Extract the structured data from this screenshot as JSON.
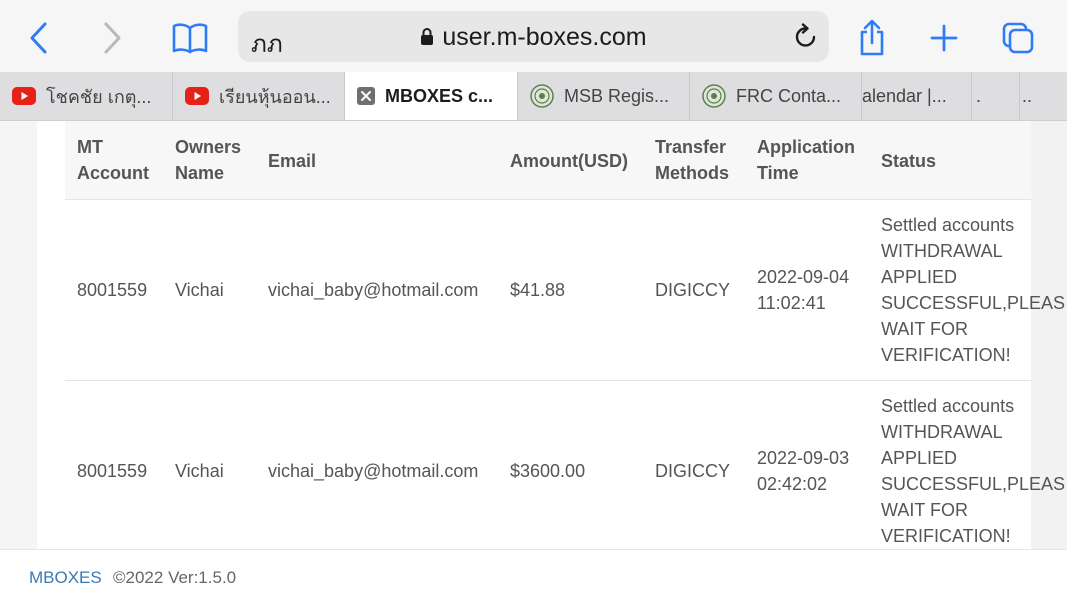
{
  "browser": {
    "text_size_label": "ภภ",
    "url": "user.m-boxes.com",
    "accent": "#2f7cf6",
    "tabs": [
      {
        "label": "โชคชัย เกตุ...",
        "icon": "youtube-icon"
      },
      {
        "label": "เรียนหุ้นออน...",
        "icon": "youtube-icon"
      },
      {
        "label": "MBOXES c...",
        "icon": "close-tab-icon"
      },
      {
        "label": "MSB Regis...",
        "icon": "seal-icon"
      },
      {
        "label": "FRC Conta...",
        "icon": "seal-icon"
      },
      {
        "label": "alendar |..."
      },
      {
        "label": "."
      },
      {
        "label": ".."
      }
    ]
  },
  "table": {
    "headers": {
      "account": [
        "MT",
        "Account"
      ],
      "owner": [
        "Owners",
        "Name"
      ],
      "email": "Email",
      "amount": "Amount(USD)",
      "method": [
        "Transfer",
        "Methods"
      ],
      "time": [
        "Application",
        "Time"
      ],
      "status": "Status"
    },
    "rows": [
      {
        "account": "8001559",
        "owner": "Vichai",
        "email": "vichai_baby@hotmail.com",
        "amount": "$41.88",
        "method": "DIGICCY",
        "date": "2022-09-04",
        "time": "11:02:41",
        "status": [
          "Settled accounts",
          "WITHDRAWAL",
          "APPLIED",
          "SUCCESSFUL,PLEAS",
          "WAIT FOR",
          "VERIFICATION!"
        ]
      },
      {
        "account": "8001559",
        "owner": "Vichai",
        "email": "vichai_baby@hotmail.com",
        "amount": "$3600.00",
        "method": "DIGICCY",
        "date": "2022-09-03",
        "time": "02:42:02",
        "status": [
          "Settled accounts",
          "WITHDRAWAL",
          "APPLIED",
          "SUCCESSFUL,PLEAS",
          "WAIT FOR",
          "VERIFICATION!"
        ]
      }
    ]
  },
  "footer": {
    "brand": "MBOXES",
    "version": "©2022 Ver:1.5.0"
  }
}
